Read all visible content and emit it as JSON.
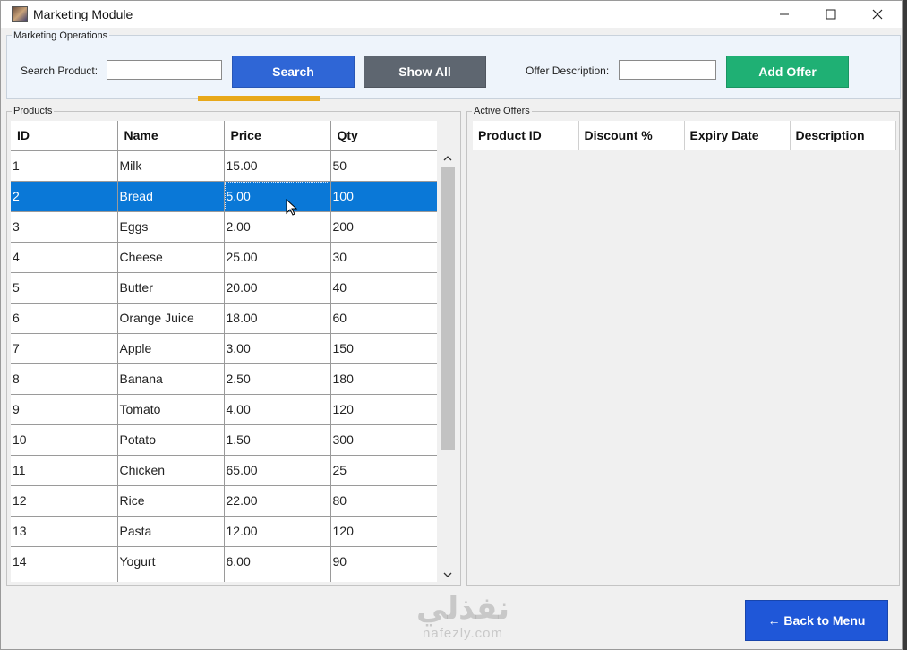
{
  "window": {
    "title": "Marketing Module",
    "icons": {
      "app": "app-icon",
      "minimize": "minimize-icon",
      "maximize": "maximize-icon",
      "close": "close-icon"
    }
  },
  "operations": {
    "legend": "Marketing Operations",
    "search_label": "Search Product:",
    "search_value": "",
    "search_button": "Search",
    "show_all_button": "Show All",
    "offer_desc_label": "Offer Description:",
    "offer_desc_value": "",
    "add_offer_button": "Add Offer",
    "colors": {
      "search": "#2f66d6",
      "show_all": "#5e6670",
      "add_offer": "#1fb074",
      "focus": "#e8a81a"
    }
  },
  "products": {
    "legend": "Products",
    "columns": [
      "ID",
      "Name",
      "Price",
      "Qty"
    ],
    "selected_row": 1,
    "rows": [
      [
        "1",
        "Milk",
        "15.00",
        "50"
      ],
      [
        "2",
        "Bread",
        "5.00",
        "100"
      ],
      [
        "3",
        "Eggs",
        "2.00",
        "200"
      ],
      [
        "4",
        "Cheese",
        "25.00",
        "30"
      ],
      [
        "5",
        "Butter",
        "20.00",
        "40"
      ],
      [
        "6",
        "Orange Juice",
        "18.00",
        "60"
      ],
      [
        "7",
        "Apple",
        "3.00",
        "150"
      ],
      [
        "8",
        "Banana",
        "2.50",
        "180"
      ],
      [
        "9",
        "Tomato",
        "4.00",
        "120"
      ],
      [
        "10",
        "Potato",
        "1.50",
        "300"
      ],
      [
        "11",
        "Chicken",
        "65.00",
        "25"
      ],
      [
        "12",
        "Rice",
        "22.00",
        "80"
      ],
      [
        "13",
        "Pasta",
        "12.00",
        "120"
      ],
      [
        "14",
        "Yogurt",
        "6.00",
        "90"
      ],
      [
        "",
        "",
        "",
        ""
      ]
    ],
    "selection_color": "#0a78d7"
  },
  "offers": {
    "legend": "Active Offers",
    "columns": [
      "Product ID",
      "Discount %",
      "Expiry Date",
      "Description"
    ],
    "rows": []
  },
  "footer": {
    "back_button": "← Back to Menu",
    "watermark_ar": "نفذلي",
    "watermark_en": "nafezly.com"
  }
}
